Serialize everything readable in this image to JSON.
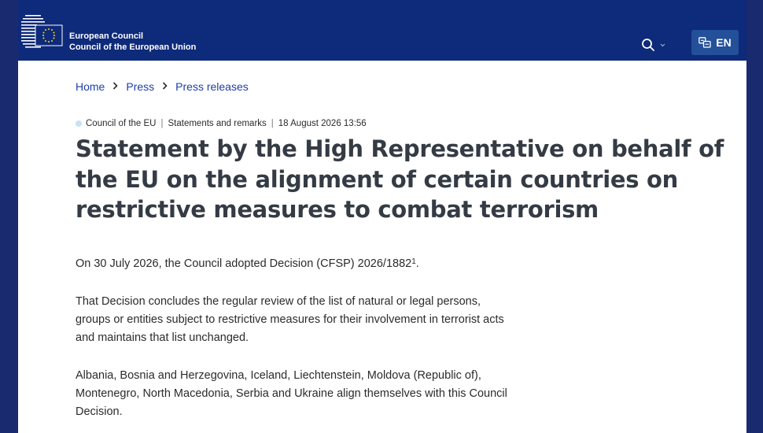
{
  "header": {
    "brand_line1": "European Council",
    "brand_line2": "Council of the European Union",
    "language_label": "EN",
    "search_icon": "search-icon",
    "language_icon": "translate-icon",
    "colors": {
      "header_bg": "#0e2a7a",
      "lang_bg": "#24509a",
      "link": "#1c3fa8"
    }
  },
  "breadcrumb": {
    "items": [
      "Home",
      "Press",
      "Press releases"
    ]
  },
  "meta": {
    "institution": "Council of the EU",
    "category": "Statements and remarks",
    "date": "18 August 2026 13:56"
  },
  "article": {
    "title": "Statement by the High Representative on behalf of the EU on the alignment of certain countries on restrictive measures to combat terrorism",
    "p1_text": "On 30 July 2026, the Council adopted Decision (CFSP) 2026/1882",
    "p1_footnote": "1",
    "p1_end": ".",
    "p2": "That Decision concludes the regular review of the list of natural or legal persons, groups or entities subject to restrictive measures for their involvement in terrorist acts and maintains that list unchanged.",
    "p3": "Albania, Bosnia and Herzegovina, Iceland, Liechtenstein, Moldova (Republic of), Montenegro, North Macedonia, Serbia and Ukraine align themselves with this Council Decision."
  }
}
